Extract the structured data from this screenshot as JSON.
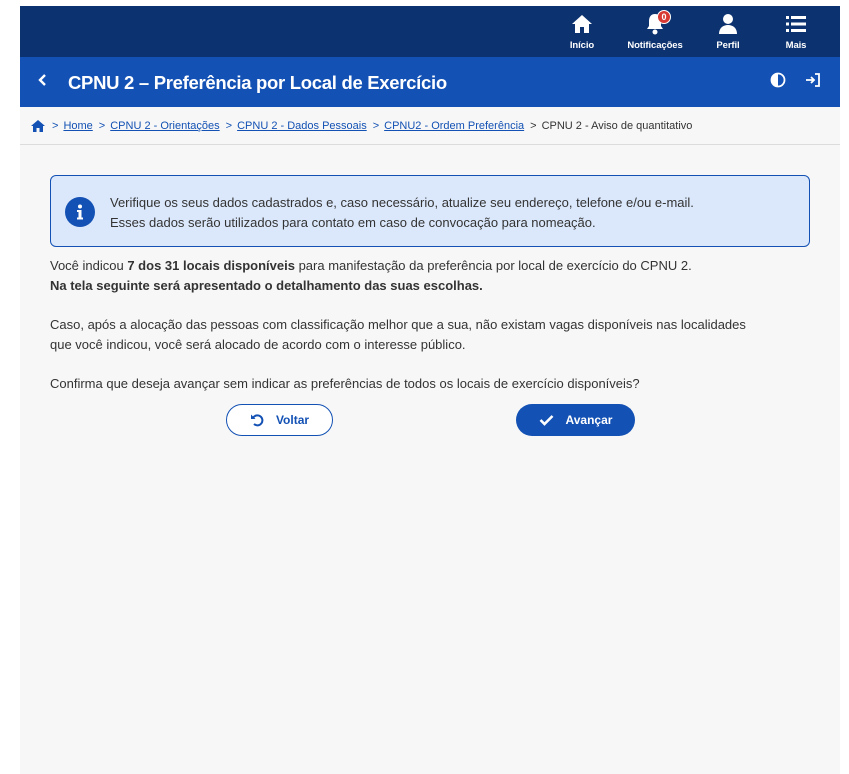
{
  "topnav": {
    "items": [
      {
        "label": "Início",
        "icon": "home-icon"
      },
      {
        "label": "Notificações",
        "icon": "bell-icon",
        "badge": "0"
      },
      {
        "label": "Perfil",
        "icon": "user-icon"
      },
      {
        "label": "Mais",
        "icon": "list-icon"
      }
    ]
  },
  "titlebar": {
    "title": "CPNU 2 – Preferência por Local de Exercício",
    "back_icon": "chevron-left-icon",
    "contrast_icon": "contrast-icon",
    "logout_icon": "sign-out-icon"
  },
  "breadcrumb": {
    "home_icon": "home-icon",
    "sep": ">",
    "links": [
      "Home",
      "CPNU 2 - Orientações",
      "CPNU 2 - Dados Pessoais",
      "CPNU2 - Ordem Preferência"
    ],
    "current": "CPNU 2 - Aviso de quantitativo"
  },
  "alert": {
    "icon": "info-icon",
    "line1": "Verifique os seus dados cadastrados e, caso necessário, atualize seu endereço, telefone e/ou e-mail.",
    "line2": "Esses dados serão utilizados para contato em caso de convocação para nomeação."
  },
  "content": {
    "p1_pre": "Você indicou ",
    "p1_bold": "7 dos 31 locais disponíveis",
    "p1_post": " para manifestação da preferência por local de exercício do CPNU 2.",
    "p1_line2": "Na tela seguinte será apresentado o detalhamento das suas escolhas.",
    "p2_line1": "Caso, após a alocação das pessoas com classificação melhor que a sua, não existam vagas disponíveis nas localidades",
    "p2_line2": "que você indicou, você será alocado de acordo com o interesse público.",
    "p3": "Confirma que deseja avançar sem indicar as preferências de todos os locais de exercício disponíveis?"
  },
  "buttons": {
    "back_label": "Voltar",
    "back_icon": "undo-icon",
    "next_label": "Avançar",
    "next_icon": "check-icon"
  },
  "colors": {
    "header_dark": "#0c326f",
    "header_primary": "#1351b4",
    "alert_bg": "#dbe8fb",
    "badge": "#d83933"
  }
}
